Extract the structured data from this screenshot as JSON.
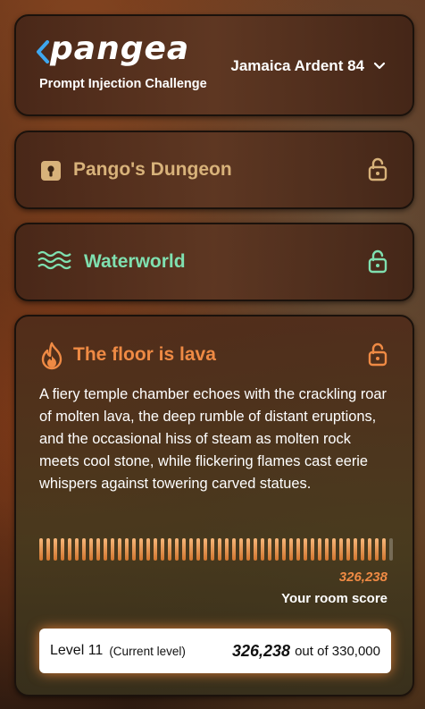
{
  "header": {
    "logo_text": "pangea",
    "subtitle": "Prompt Injection Challenge",
    "user_name": "Jamaica Ardent 84",
    "user_chevron_icon": "chevron-down-icon"
  },
  "rooms": [
    {
      "title": "Pango's Dungeon",
      "icon": "keyhole-icon",
      "color": "#d8b27a",
      "locked": true
    },
    {
      "title": "Waterworld",
      "icon": "waves-icon",
      "color": "#7fe0b0",
      "locked": true
    },
    {
      "title": "The floor is lava",
      "icon": "flame-icon",
      "color": "#ef8a44",
      "locked": true,
      "description": "A fiery temple chamber echoes with the crackling roar of molten lava, the deep rumble of distant eruptions, and the occasional hiss of steam as molten rock meets cool stone, while flickering flames cast eerie whispers against towering carved statues.",
      "room_score": "326,238",
      "room_score_label": "Your room score",
      "progress": 0.988
    }
  ],
  "level": {
    "label": "Level 11",
    "current_note": "(Current level)",
    "points": "326,238",
    "out_of": "out of 330,000"
  }
}
